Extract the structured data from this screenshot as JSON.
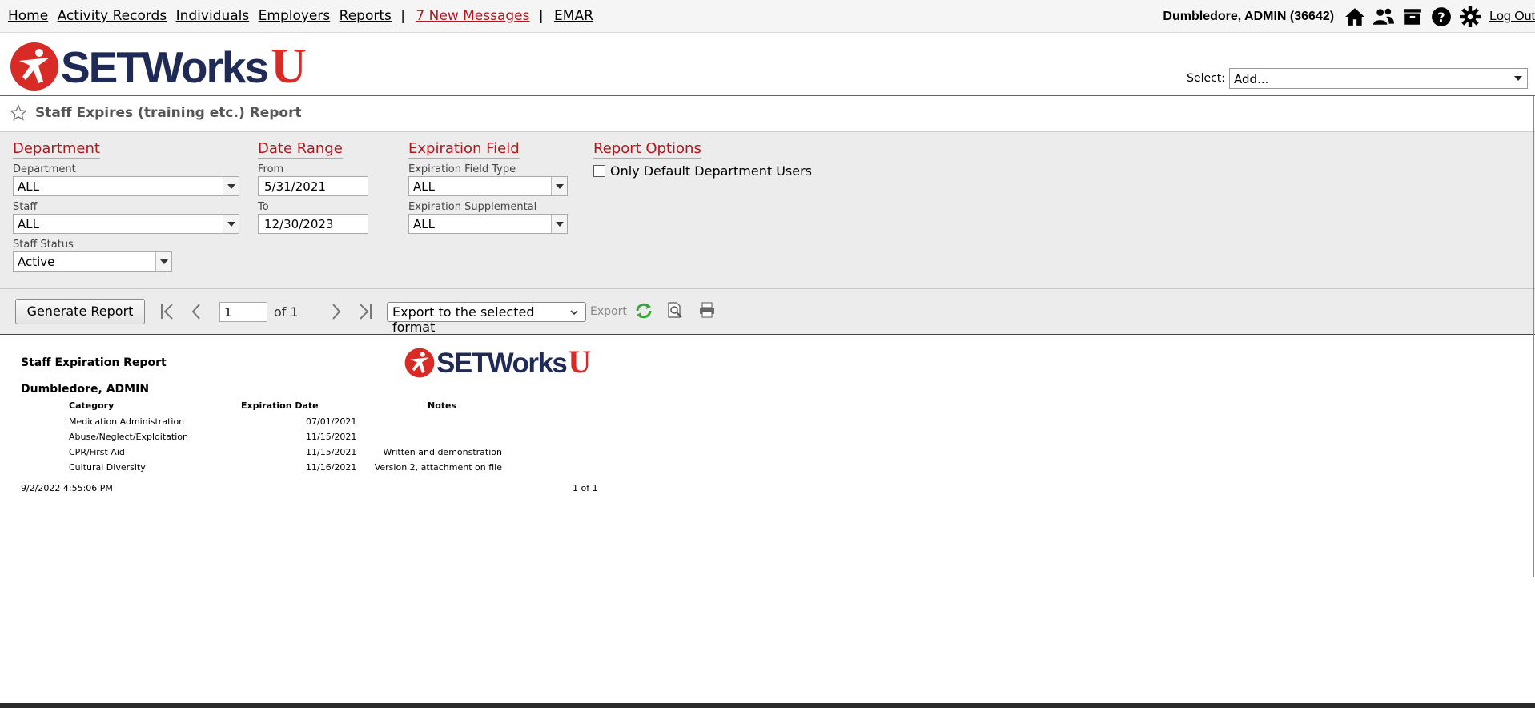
{
  "nav": {
    "links": [
      "Home",
      "Activity Records",
      "Individuals",
      "Employers",
      "Reports"
    ],
    "messages": "7 New Messages",
    "emar": "EMAR",
    "separator": "|",
    "user": "Dumbledore, ADMIN  (36642)",
    "logout": "Log Out",
    "icons": [
      "home-icon",
      "users-icon",
      "folder-icon",
      "help-icon",
      "gear-icon"
    ]
  },
  "header": {
    "logo_text": "SETWorks",
    "logo_u": "U",
    "select_label": "Select:",
    "select_value": "Add..."
  },
  "page": {
    "title": "Staff Expires (training etc.) Report"
  },
  "filters": {
    "department": {
      "heading": "Department",
      "dept_label": "Department",
      "dept_value": "ALL",
      "staff_label": "Staff",
      "staff_value": "ALL",
      "status_label": "Staff Status",
      "status_value": "Active"
    },
    "date_range": {
      "heading": "Date Range",
      "from_label": "From",
      "from_value": "5/31/2021",
      "to_label": "To",
      "to_value": "12/30/2023"
    },
    "expiration": {
      "heading": "Expiration Field",
      "type_label": "Expiration Field Type",
      "type_value": "ALL",
      "supp_label": "Expiration Supplemental",
      "supp_value": "ALL"
    },
    "options": {
      "heading": "Report Options",
      "default_users_label": "Only Default Department Users"
    }
  },
  "toolbar": {
    "generate_label": "Generate Report",
    "page_value": "1",
    "of_label": "of 1",
    "export_select": "Export to the selected format",
    "export_label": "Export"
  },
  "report": {
    "title": "Staff Expiration Report",
    "person": "Dumbledore, ADMIN",
    "logo_text": "SETWorks",
    "logo_u": "U",
    "columns": [
      "Category",
      "Expiration Date",
      "Notes"
    ],
    "rows": [
      {
        "category": "Medication Administration",
        "date": "07/01/2021",
        "notes": ""
      },
      {
        "category": "Abuse/Neglect/Exploitation",
        "date": "11/15/2021",
        "notes": ""
      },
      {
        "category": "CPR/First Aid",
        "date": "11/15/2021",
        "notes": "Written and demonstration"
      },
      {
        "category": "Cultural Diversity",
        "date": "11/16/2021",
        "notes": "Version 2, attachment on file"
      }
    ],
    "timestamp": "9/2/2022 4:55:06 PM",
    "page_count": "1 of 1"
  },
  "colors": {
    "brand_red": "#b0171e",
    "brand_navy": "#1f2a57"
  }
}
